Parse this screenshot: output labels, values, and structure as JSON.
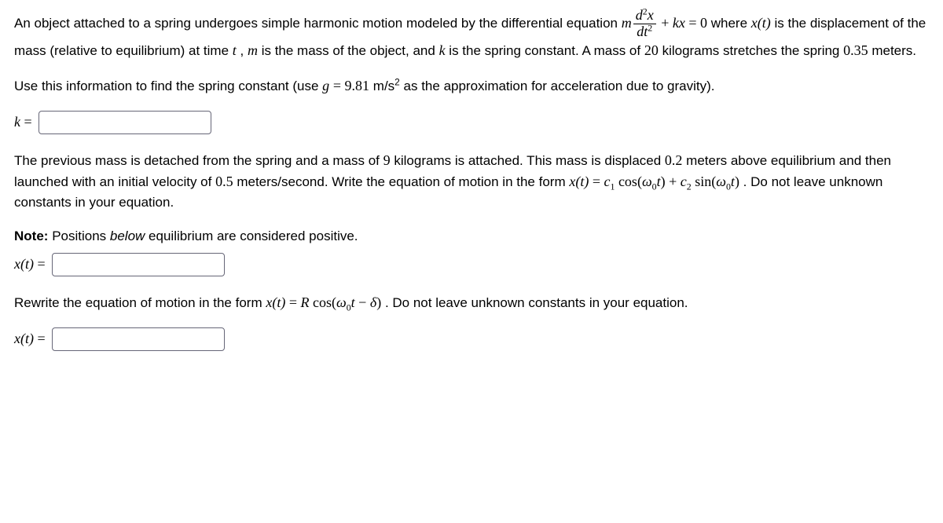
{
  "problem": {
    "intro_part1": "An object attached to a spring undergoes simple harmonic motion modeled by the differential equation ",
    "intro_part2": " where ",
    "intro_part3": " is the displacement of the mass (relative to equilibrium) at time ",
    "intro_part4": ", ",
    "intro_part5": " is the mass of the object, and ",
    "intro_part6": " is the spring constant. A mass of ",
    "mass1": "20",
    "intro_part7": " kilograms stretches the spring ",
    "stretch": "0.35",
    "intro_part8": " meters.",
    "q1_part1": "Use this information to find the spring constant (use ",
    "g_val": "9.81",
    "q1_part2": " m/s",
    "q1_part3": " as the approximation for acceleration due to gravity).",
    "k_label": "k =",
    "q2_part1": "The previous mass is detached from the spring and a mass of ",
    "mass2": "9",
    "q2_part2": " kilograms is attached. This mass is displaced ",
    "disp": "0.2",
    "q2_part3": " meters above equilibrium and then launched with an initial velocity of ",
    "vel": "0.5",
    "q2_part4": " meters/second. Write the equation of motion in the form ",
    "q2_part5": ". Do not leave unknown constants in your equation.",
    "note_label": "Note:",
    "note_text": " Positions ",
    "note_em": "below",
    "note_text2": " equilibrium are considered positive.",
    "xt_label": "x(t) =",
    "q3_part1": "Rewrite the equation of motion in the form ",
    "q3_part2": ". Do not leave unknown constants in your equation."
  },
  "math": {
    "m": "m",
    "d2x": "d",
    "x": "x",
    "dt2": "dt",
    "plus": " + ",
    "k": "k",
    "kx": "kx",
    "eq": " = ",
    "zero": "0",
    "xt_open": "x(t)",
    "t": "t",
    "g": "g",
    "two": "2",
    "c1": "c",
    "c2": "c",
    "one_sub": "1",
    "two_sub": "2",
    "cos": " cos",
    "sin": " sin",
    "omega": "ω",
    "zero_sub": "0",
    "R": "R",
    "minus": " − ",
    "delta": "δ",
    "lparen": "(",
    "rparen": ")"
  }
}
